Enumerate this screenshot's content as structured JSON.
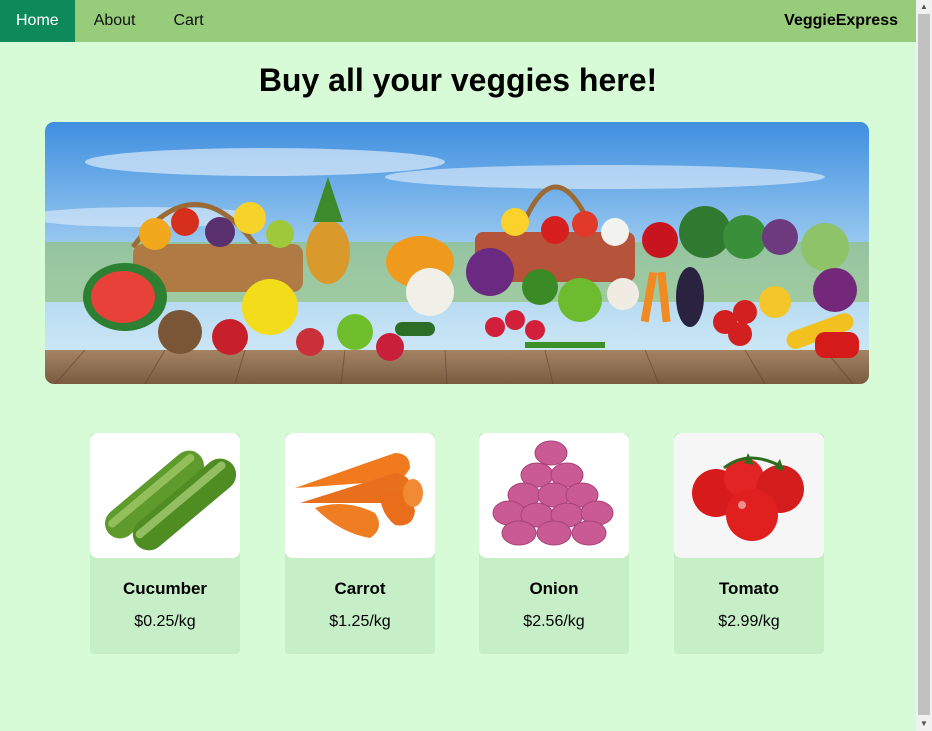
{
  "nav": {
    "links": [
      {
        "label": "Home"
      },
      {
        "label": "About"
      },
      {
        "label": "Cart"
      }
    ],
    "brand": "VeggieExpress"
  },
  "main": {
    "title": "Buy all your veggies here!"
  },
  "products": [
    {
      "name": "Cucumber",
      "price": "$0.25/kg"
    },
    {
      "name": "Carrot",
      "price": "$1.25/kg"
    },
    {
      "name": "Onion",
      "price": "$2.56/kg"
    },
    {
      "name": "Tomato",
      "price": "$2.99/kg"
    }
  ],
  "colors": {
    "page_bg": "#d6fbd6",
    "navbar_bg": "#97cc7b",
    "nav_active_bg": "#0e8a5a",
    "card_bg": "#c6efc7"
  }
}
